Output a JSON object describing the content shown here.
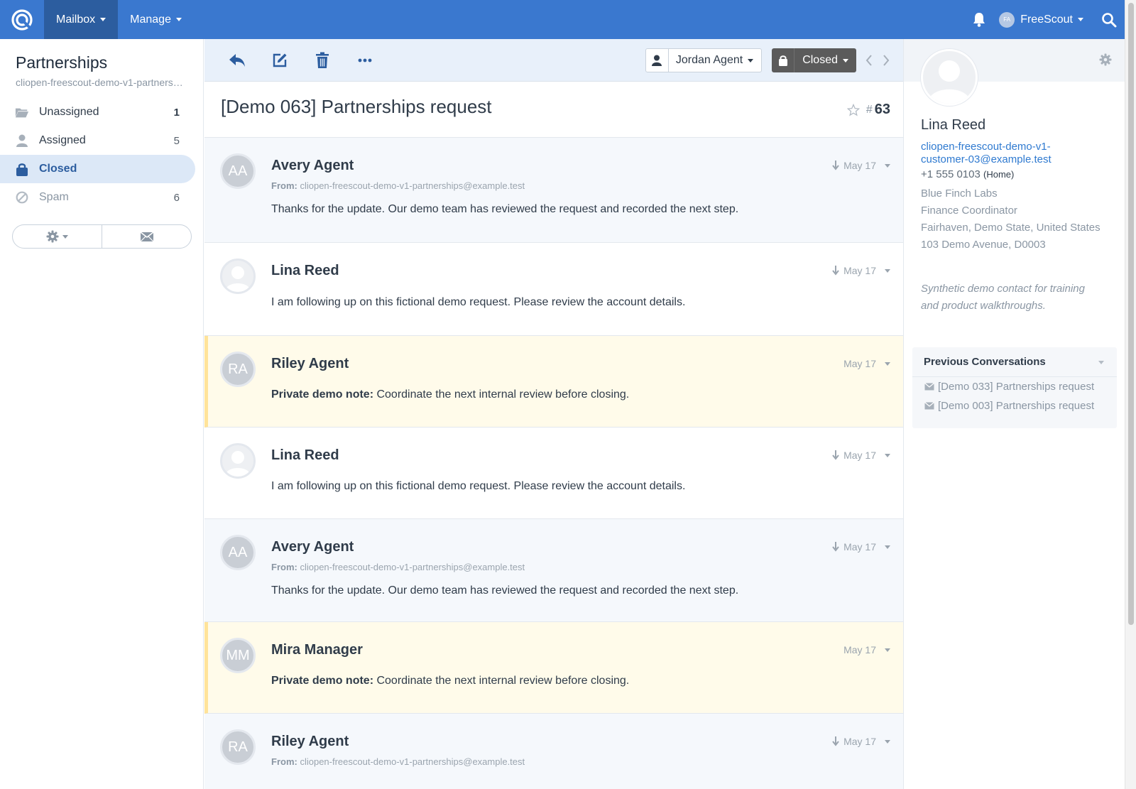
{
  "navbar": {
    "mailbox_label": "Mailbox",
    "manage_label": "Manage",
    "user_initials": "FA",
    "user_name": "FreeScout",
    "brand_color": "#3a78cf"
  },
  "sidebar": {
    "mailbox_name": "Partnerships",
    "mailbox_email": "cliopen-freescout-demo-v1-partnerships@example.test",
    "folders": [
      {
        "label": "Unassigned",
        "count": "1",
        "icon": "folder-open-icon"
      },
      {
        "label": "Assigned",
        "count": "5",
        "icon": "user-icon"
      },
      {
        "label": "Closed",
        "count": "",
        "icon": "lock-icon"
      },
      {
        "label": "Spam",
        "count": "6",
        "icon": "ban-icon"
      }
    ],
    "actions": [
      "gear-dropdown-icon",
      "envelope-icon"
    ]
  },
  "toolbar": {
    "icons": [
      "reply-icon",
      "edit-icon",
      "trash-icon",
      "more-icon"
    ],
    "assignee": "Jordan Agent",
    "status": "Closed"
  },
  "conversation": {
    "subject": "[Demo 063] Partnerships request",
    "hash": "#",
    "number": "63"
  },
  "threads": [
    {
      "type": "agent",
      "initials": "AA",
      "name": "Avery Agent",
      "from_label": "From:",
      "from": "cliopen-freescout-demo-v1-partnerships@example.test",
      "date": "May 17",
      "body": "Thanks for the update. Our demo team has reviewed the request and recorded the next step."
    },
    {
      "type": "customer",
      "initials": "",
      "name": "Lina Reed",
      "date": "May 17",
      "body": "I am following up on this fictional demo request. Please review the account details."
    },
    {
      "type": "note",
      "initials": "RA",
      "name": "Riley Agent",
      "date": "May 17",
      "note_label": "Private demo note:",
      "body": " Coordinate the next internal review before closing."
    },
    {
      "type": "customer",
      "initials": "",
      "name": "Lina Reed",
      "date": "May 17",
      "body": "I am following up on this fictional demo request. Please review the account details."
    },
    {
      "type": "agent",
      "initials": "AA",
      "name": "Avery Agent",
      "from_label": "From:",
      "from": "cliopen-freescout-demo-v1-partnerships@example.test",
      "date": "May 17",
      "body": "Thanks for the update. Our demo team has reviewed the request and recorded the next step."
    },
    {
      "type": "note",
      "initials": "MM",
      "name": "Mira Manager",
      "date": "May 17",
      "note_label": "Private demo note:",
      "body": " Coordinate the next internal review before closing."
    },
    {
      "type": "agent",
      "initials": "RA",
      "name": "Riley Agent",
      "from_label": "From:",
      "from": "cliopen-freescout-demo-v1-partnerships@example.test",
      "date": "May 17",
      "body": ""
    }
  ],
  "customer": {
    "name": "Lina Reed",
    "email": "cliopen-freescout-demo-v1-customer-03@example.test",
    "phone": "+1 555 0103",
    "phone_type": "(Home)",
    "company": "Blue Finch Labs",
    "job_title": "Finance Coordinator",
    "location": "Fairhaven, Demo State, United States",
    "address": "103 Demo Avenue, D0003",
    "notes": "Synthetic demo contact for training and product walkthroughs."
  },
  "previous_conversations": {
    "title": "Previous Conversations",
    "items": [
      "[Demo 033] Partnerships request",
      "[Demo 003] Partnerships request"
    ]
  }
}
